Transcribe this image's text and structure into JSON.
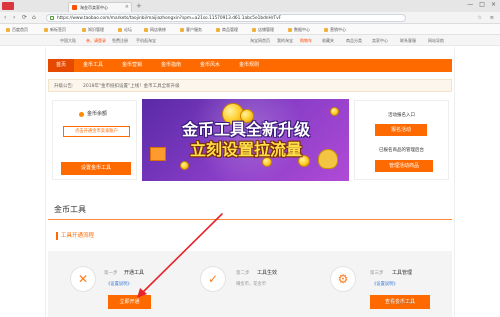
{
  "browser": {
    "tab_title": "淘金币卖家中心",
    "tab_close": "×",
    "new_tab": "+",
    "window_controls": [
      "—",
      "□",
      "×"
    ],
    "nav_buttons": [
      "‹",
      "›",
      "⟳",
      "⌂"
    ],
    "url": "https://www.taobao.com/markets/taojinbi/maijiazhongxin?spm=a21so.11570913.d61.1abc5e1bdnHrTvF",
    "addr_right": [
      "☆",
      "≡"
    ]
  },
  "bookmarks": [
    "百度首页",
    "新标签页",
    "知识管理",
    "论坛",
    "网店装修",
    "客户服务",
    "商品管理",
    "店铺管理",
    "数据中心",
    "营销中心"
  ],
  "site_top": {
    "left": [
      "中国大陆",
      "亲，请登录",
      "免费注册",
      "手机逛淘宝"
    ],
    "right": [
      "淘宝网首页",
      "我的淘宝",
      "购物车",
      "收藏夹",
      "商品分类",
      "卖家中心",
      "联系客服",
      "网站导航"
    ]
  },
  "nav": {
    "items": [
      "首页",
      "金币工具",
      "金币营销",
      "金币指南",
      "金币风水",
      "金币规则"
    ],
    "active_index": 0
  },
  "notice": {
    "label": "升级公告:",
    "text": "2018年\"金币抵扣设置\"上线！金币工具全新升级"
  },
  "left_card": {
    "title": "金币余额",
    "open_account_btn": "点击开通金币卖家账户",
    "set_coin_btn": "设置金币工具"
  },
  "banner": {
    "line1": "金币工具全新升级",
    "line2": "立刻设置拉流量"
  },
  "right_card": {
    "event_title": "活动报名入口",
    "event_btn": "报名活动",
    "manage_title": "已报名商品的管理后台",
    "manage_btn": "管理活动商品"
  },
  "section": {
    "title": "金币工具",
    "flow_title": "工具开通流程"
  },
  "steps": [
    {
      "num": "第一步",
      "name": "开通工具",
      "link": "《设置说明》",
      "icon": "wrench-icon",
      "glyph": "✕"
    },
    {
      "num": "第二步",
      "name": "工具生效",
      "sub": "赚金币，花金币",
      "icon": "check-icon",
      "glyph": "✓"
    },
    {
      "num": "第三步",
      "name": "工具管理",
      "link": "《设置说明》",
      "icon": "manage-icon",
      "glyph": "⚙"
    }
  ],
  "open_btn": "立即开通",
  "view_btn": "查看金币工具",
  "watermark": "jingyan",
  "colors": {
    "brand_orange": "#ff6a00",
    "annotation_red": "#e8242a"
  }
}
